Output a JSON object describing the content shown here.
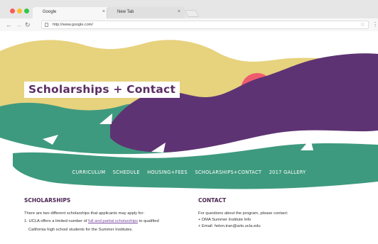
{
  "browser": {
    "tabs": [
      {
        "label": "Google",
        "active": true
      },
      {
        "label": "New Tab",
        "active": false
      }
    ],
    "tab_close_glyph": "×",
    "url": "http://www.google.com/",
    "icons": [
      "back-arrow-icon",
      "forward-arrow-icon",
      "reload-icon",
      "page-icon",
      "star-icon",
      "menu-dots-icon"
    ]
  },
  "hero": {
    "title": "Scholarships + Contact",
    "colors": {
      "sky": "#ffffff",
      "sand": "#e7d27e",
      "green": "#3e9a7e",
      "purple": "#5e3373",
      "sun": "#ef5c6d",
      "sail": "#ffffff"
    }
  },
  "nav": {
    "items": [
      "CURRICULUM",
      "SCHEDULE",
      "HOUSING+FEES",
      "SCHOLARSHIPS+CONTACT",
      "2017 GALLERY"
    ]
  },
  "scholarships": {
    "title": "SCHOLARSHIPS",
    "intro": "There are two different scholarships that applicants may apply for:",
    "item1_prefix": "1. UCLA offers a limited number of ",
    "item1_link": "full and partial scholarships",
    "item1_suffix": " to qualified",
    "item1_line2": "California high school students for the Summer Institutes."
  },
  "contact": {
    "title": "CONTACT",
    "intro": "For questions about the program, please contact:",
    "items": [
      "+  DMA Summer Institute Info",
      "+  Email: helen.tran@arts.ucla.edu"
    ]
  }
}
